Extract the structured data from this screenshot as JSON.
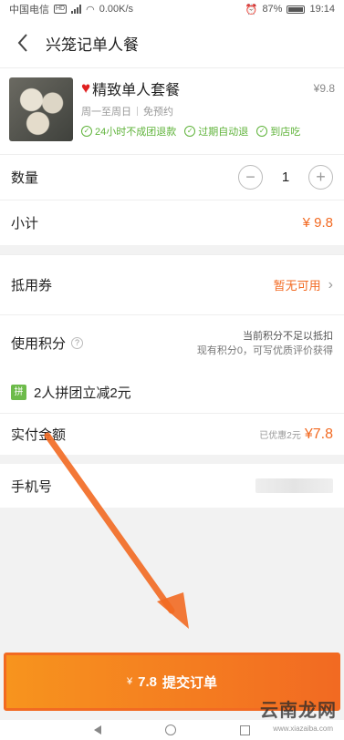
{
  "status_bar": {
    "carrier": "中国电信",
    "hd": "HD",
    "speed": "0.00K/s",
    "battery": "87%",
    "time": "19:14"
  },
  "nav": {
    "title": "兴笼记单人餐"
  },
  "product": {
    "name": "精致单人套餐",
    "price": "¥9.8",
    "days": "周一至周日",
    "reservation": "免预约",
    "tags": [
      "24小时不成团退款",
      "过期自动退",
      "到店吃"
    ]
  },
  "quantity": {
    "label": "数量",
    "minus": "−",
    "value": "1",
    "plus": "+"
  },
  "subtotal": {
    "label": "小计",
    "value": "¥ 9.8"
  },
  "voucher": {
    "label": "抵用券",
    "value": "暂无可用"
  },
  "points": {
    "label": "使用积分",
    "help": "?",
    "line1": "当前积分不足以抵扣",
    "line2": "现有积分0，可写优质评价获得"
  },
  "group_buy": {
    "badge": "拼",
    "text": "2人拼团立减2元"
  },
  "paid": {
    "label": "实付金额",
    "discount_note": "已优惠2元",
    "value": "¥7.8"
  },
  "phone": {
    "label": "手机号"
  },
  "submit": {
    "yen": "¥",
    "amount": "7.8",
    "label": "提交订单"
  },
  "watermark": {
    "text": "云南龙网",
    "url": "www.xiazaiba.com"
  },
  "colors": {
    "accent": "#f26a22",
    "green": "#5fb33a"
  }
}
